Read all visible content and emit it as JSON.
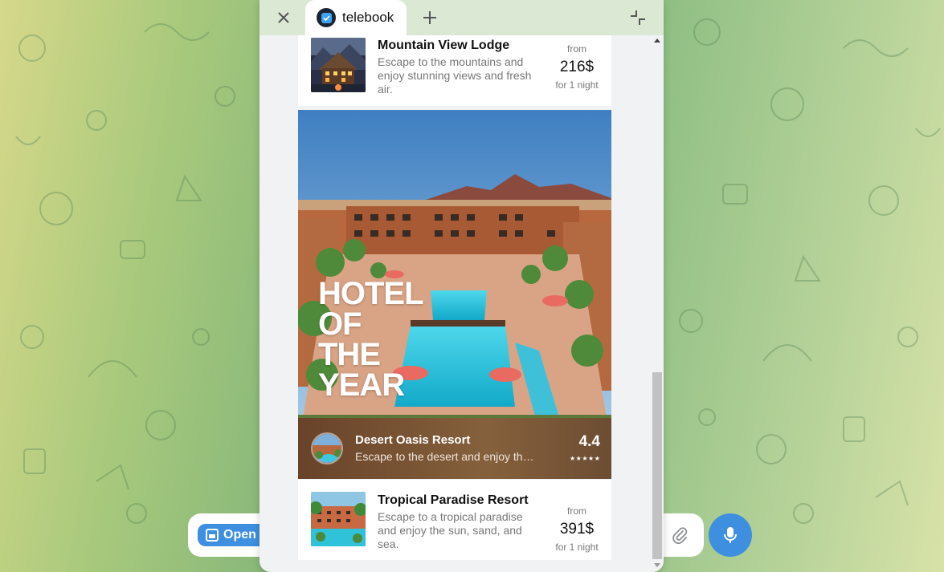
{
  "background": {
    "colors": {
      "accent": "#3e8fe0",
      "wallpaper_start": "#d6d88a",
      "wallpaper_mid": "#7fb37a"
    },
    "open_button_label": "Open",
    "icons": [
      "paperclip-icon",
      "microphone-icon",
      "window-icon"
    ]
  },
  "window": {
    "tab_title": "telebook",
    "icons": [
      "close-icon",
      "plus-icon",
      "collapse-icon",
      "telebook-logo-icon"
    ]
  },
  "hotels": [
    {
      "name": "Mountain View Lodge",
      "description": "Escape to the mountains and enjoy stunning views and fresh air.",
      "price_prefix": "from",
      "price": "216$",
      "price_suffix": "for 1 night"
    },
    {
      "name": "Tropical Paradise Resort",
      "description": "Escape to a tropical paradise and enjoy the sun, sand, and sea.",
      "price_prefix": "from",
      "price": "391$",
      "price_suffix": "for 1 night"
    }
  ],
  "featured": {
    "banner": "HOTEL\nOF\nTHE\nYEAR",
    "name": "Desert Oasis Resort",
    "description": "Escape to the desert and enjoy the…",
    "rating": "4.4",
    "stars": "★★★★★"
  }
}
